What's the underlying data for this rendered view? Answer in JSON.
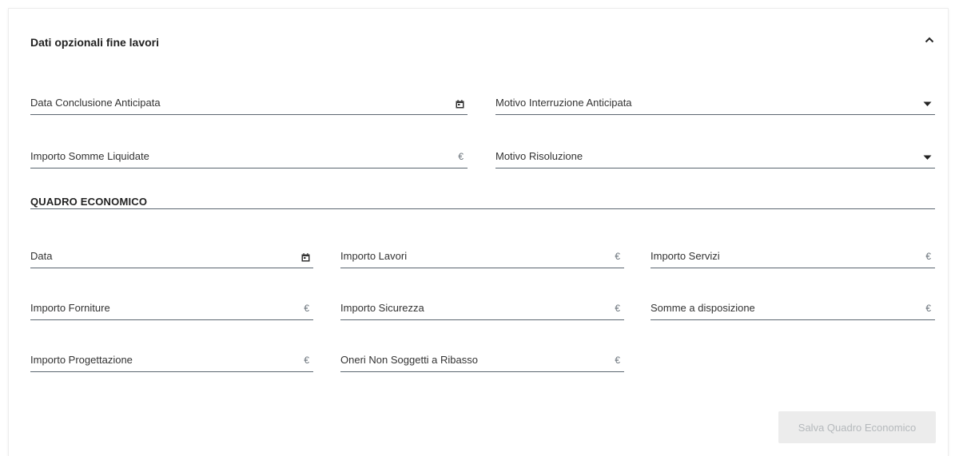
{
  "header": {
    "title": "Dati opzionali fine lavori"
  },
  "fine_lavori": {
    "data_conclusione": {
      "label": "Data Conclusione Anticipata"
    },
    "motivo_interruzione": {
      "label": "Motivo Interruzione Anticipata"
    },
    "importo_somme": {
      "label": "Importo Somme Liquidate",
      "suffix": "€"
    },
    "motivo_risoluzione": {
      "label": "Motivo Risoluzione"
    }
  },
  "quadro": {
    "title": "QUADRO ECONOMICO",
    "data": {
      "label": "Data"
    },
    "importo_lavori": {
      "label": "Importo Lavori",
      "suffix": "€"
    },
    "importo_servizi": {
      "label": "Importo Servizi",
      "suffix": "€"
    },
    "importo_forniture": {
      "label": "Importo Forniture",
      "suffix": "€"
    },
    "importo_sicurezza": {
      "label": "Importo Sicurezza",
      "suffix": "€"
    },
    "somme_disposizione": {
      "label": "Somme a disposizione",
      "suffix": "€"
    },
    "importo_progettazione": {
      "label": "Importo Progettazione",
      "suffix": "€"
    },
    "oneri_non_soggetti": {
      "label": "Oneri Non Soggetti a Ribasso",
      "suffix": "€"
    }
  },
  "actions": {
    "save_label": "Salva Quadro Economico"
  },
  "icons": {
    "collapse": "chevron-up-icon",
    "calendar": "calendar-icon",
    "dropdown": "caret-down-icon"
  },
  "colors": {
    "underline": "#5b6670",
    "disabled_button_bg": "#ececec",
    "disabled_button_text": "#b5b9bc"
  }
}
